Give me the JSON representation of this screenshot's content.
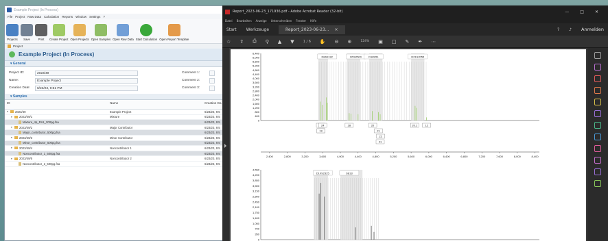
{
  "app": {
    "title": "Example Project (In Process)",
    "menu": [
      "File",
      "Project",
      "Raw Data",
      "Calculation",
      "Reports",
      "Window",
      "Settings",
      "?"
    ],
    "ribbon": [
      {
        "label": "Projects",
        "icon": "projects-icon",
        "color": "#2b6cb8"
      },
      {
        "label": "Save",
        "icon": "save-icon",
        "color": "#5a6c80"
      },
      {
        "label": "Print",
        "icon": "print-icon",
        "color": "#444444"
      },
      {
        "label": "Create Project",
        "icon": "create-project-icon",
        "color": "#8fc24a"
      },
      {
        "label": "Open Projects",
        "icon": "open-projects-icon",
        "color": "#e3a73c"
      },
      {
        "label": "Open Samples",
        "icon": "open-samples-icon",
        "color": "#7cb34a"
      },
      {
        "label": "Open Raw Data",
        "icon": "open-raw-data-icon",
        "color": "#5b8fd0"
      },
      {
        "label": "Start Calculation",
        "icon": "start-calculation-icon",
        "color": "#3aa83a"
      },
      {
        "label": "Open Report Template",
        "icon": "open-report-template-icon",
        "color": "#e08a2a"
      }
    ],
    "tab": "Project",
    "project_title": "Example Project (In Process)",
    "general": {
      "section": "General",
      "rows": [
        {
          "k": "Project ID:",
          "v": "2023/49",
          "k2": "Comment 1:"
        },
        {
          "k": "Name:",
          "v": "Example Project",
          "k2": "Comment 2:"
        },
        {
          "k": "Creation Date:",
          "v": "6/23/23, 9:51 PM",
          "k2": "Comment 3:"
        }
      ]
    },
    "samples": {
      "section": "Samples",
      "headers": [
        "ID",
        "Name",
        "Creation Da"
      ],
      "rows": [
        {
          "indent": 0,
          "tw": "▾",
          "kind": "folder",
          "id": "2023/49",
          "name": "Example Project",
          "date": "6/23/23, 9:5",
          "hl": false
        },
        {
          "indent": 1,
          "tw": "▾",
          "kind": "folder",
          "id": "2023/49/1",
          "name": "Mixture",
          "date": "6/23/23, 9:5",
          "hl": false
        },
        {
          "indent": 2,
          "tw": "",
          "kind": "file",
          "id": "Mixture_4p_Rn1_200pg.fsa",
          "name": "",
          "date": "6/23/23, 9:5",
          "hl": true
        },
        {
          "indent": 1,
          "tw": "▾",
          "kind": "folder",
          "id": "2023/49/2",
          "name": "Major Contributor",
          "date": "6/23/23, 9:5",
          "hl": false
        },
        {
          "indent": 2,
          "tw": "",
          "kind": "file",
          "id": "Major_contributor_500pg.fsa",
          "name": "",
          "date": "6/23/23, 9:5",
          "hl": true
        },
        {
          "indent": 1,
          "tw": "▾",
          "kind": "folder",
          "id": "2023/49/3",
          "name": "Minor Contributor",
          "date": "6/23/23, 9:5",
          "hl": false
        },
        {
          "indent": 2,
          "tw": "",
          "kind": "file",
          "id": "Minor_contributor_500pg.fsa",
          "name": "",
          "date": "6/23/23, 9:5",
          "hl": true
        },
        {
          "indent": 1,
          "tw": "▾",
          "kind": "folder",
          "id": "2023/49/4",
          "name": "Noncontributor 1",
          "date": "6/23/23, 9:5",
          "hl": false
        },
        {
          "indent": 2,
          "tw": "",
          "kind": "file",
          "id": "Noncontributor_1_500pg.fsa",
          "name": "",
          "date": "6/23/23, 9:5",
          "hl": true
        },
        {
          "indent": 1,
          "tw": "▾",
          "kind": "folder",
          "id": "2023/49/5",
          "name": "Noncontributor 2",
          "date": "6/23/23, 9:5",
          "hl": false
        },
        {
          "indent": 2,
          "tw": "",
          "kind": "file",
          "id": "Noncontributor_2_500pg.fsa",
          "name": "",
          "date": "6/23/23, 9:5",
          "hl": false
        }
      ]
    }
  },
  "pdf": {
    "title": "Report_2023-06-23_171936.pdf - Adobe Acrobat Reader (32-bit)",
    "window_buttons": [
      "—",
      "□",
      "✕"
    ],
    "menu": [
      "Datei",
      "Bearbeiten",
      "Anzeige",
      "Unterschreiben",
      "Fenster",
      "Hilfe"
    ],
    "tabs": {
      "start": "Start",
      "tools": "Werkzeuge",
      "doc": "Report_2023-06-23...",
      "close": "×"
    },
    "help_icon": "?",
    "bell_icon": "♪",
    "signin": "Anmelden",
    "page_indicator": "1 / 6",
    "zoom": "124%",
    "toolbar_icons": [
      "star-icon",
      "upload-icon",
      "print-icon",
      "search-icon",
      "zoom-icon",
      "up-icon",
      "down-icon",
      "hand-icon",
      "zoom-out-icon",
      "zoom-in-icon",
      "fit-icon",
      "comment-icon",
      "highlight-icon",
      "pen-icon",
      "sign-icon",
      "more-icon"
    ],
    "side_colors": [
      "#9e9e9e",
      "#b86fd0",
      "#e05a5a",
      "#e07a4a",
      "#d8c04a",
      "#9a6fd8",
      "#4ab88a",
      "#4a9ad8",
      "#e05a9a",
      "#c86fd0",
      "#9a6fd8",
      "#8ac85a"
    ]
  },
  "chart_data": [
    {
      "type": "line",
      "title": "",
      "y_ticks": [
        "6,400",
        "6,000",
        "5,600",
        "5,200",
        "4,800",
        "4,400",
        "4,000",
        "3,600",
        "3,200",
        "2,800",
        "2,400",
        "2,000",
        "1,600",
        "1,200",
        "800",
        "400",
        "0"
      ],
      "ylim": [
        0,
        6400
      ],
      "x_ticks": [
        "2,400",
        "2,800",
        "3,200",
        "3,600",
        "4,000",
        "4,400",
        "4,800",
        "5,200",
        "5,600",
        "6,000",
        "6,400",
        "6,800",
        "7,200",
        "7,600",
        "8,000",
        "8,400"
      ],
      "xlim": [
        2200,
        8500
      ],
      "markers": [
        "D8S1132",
        "D5S2500",
        "D18S51",
        "D21S2055"
      ],
      "markers_x": [
        3700,
        4350,
        4750,
        5750
      ],
      "allele_labels": [
        "23",
        "24",
        "18",
        "19",
        "28",
        "20",
        "21",
        "22",
        "21",
        "20.1",
        "12"
      ],
      "alleles_x": [
        3550,
        3600,
        3560,
        3560,
        4200,
        4730,
        4860,
        4910,
        4900,
        5680,
        5950
      ]
    },
    {
      "type": "line",
      "title": "",
      "y_ticks": [
        "4,550",
        "4,200",
        "3,850",
        "3,500",
        "3,150",
        "2,800",
        "2,450",
        "2,100",
        "1,750",
        "1,400",
        "1,050",
        "700",
        "350",
        "0"
      ],
      "ylim": [
        0,
        4550
      ],
      "markers": [
        "D10S2325",
        "SE33"
      ],
      "markers_x": [
        3600,
        4200
      ]
    }
  ]
}
